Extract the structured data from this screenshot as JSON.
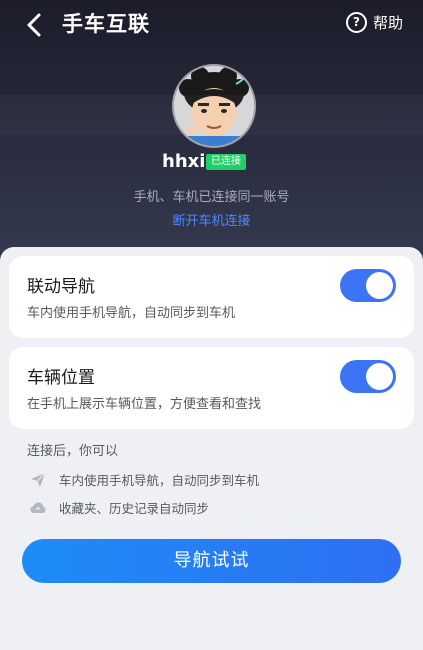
{
  "header": {
    "title": "手车互联",
    "help_label": "帮助"
  },
  "profile": {
    "username": "hhxi",
    "status_badge": "已连接",
    "account_text": "手机、车机已连接同一账号",
    "disconnect_label": "断开车机连接"
  },
  "settings": [
    {
      "title": "联动导航",
      "description": "车内使用手机导航，自动同步到车机",
      "enabled": true
    },
    {
      "title": "车辆位置",
      "description": "在手机上展示车辆位置，方便查看和查找",
      "enabled": true
    }
  ],
  "features_section": {
    "title": "连接后，你可以",
    "items": [
      {
        "icon": "paper-plane-icon",
        "text": "车内使用手机导航，自动同步到车机"
      },
      {
        "icon": "cloud-icon",
        "text": "收藏夹、历史记录自动同步"
      }
    ]
  },
  "primary_button": {
    "label": "导航试试"
  },
  "colors": {
    "accent": "#3b74f4",
    "badge": "#1fcf6a",
    "link": "#4e87ff",
    "header_bg": "#1c1c2a"
  }
}
